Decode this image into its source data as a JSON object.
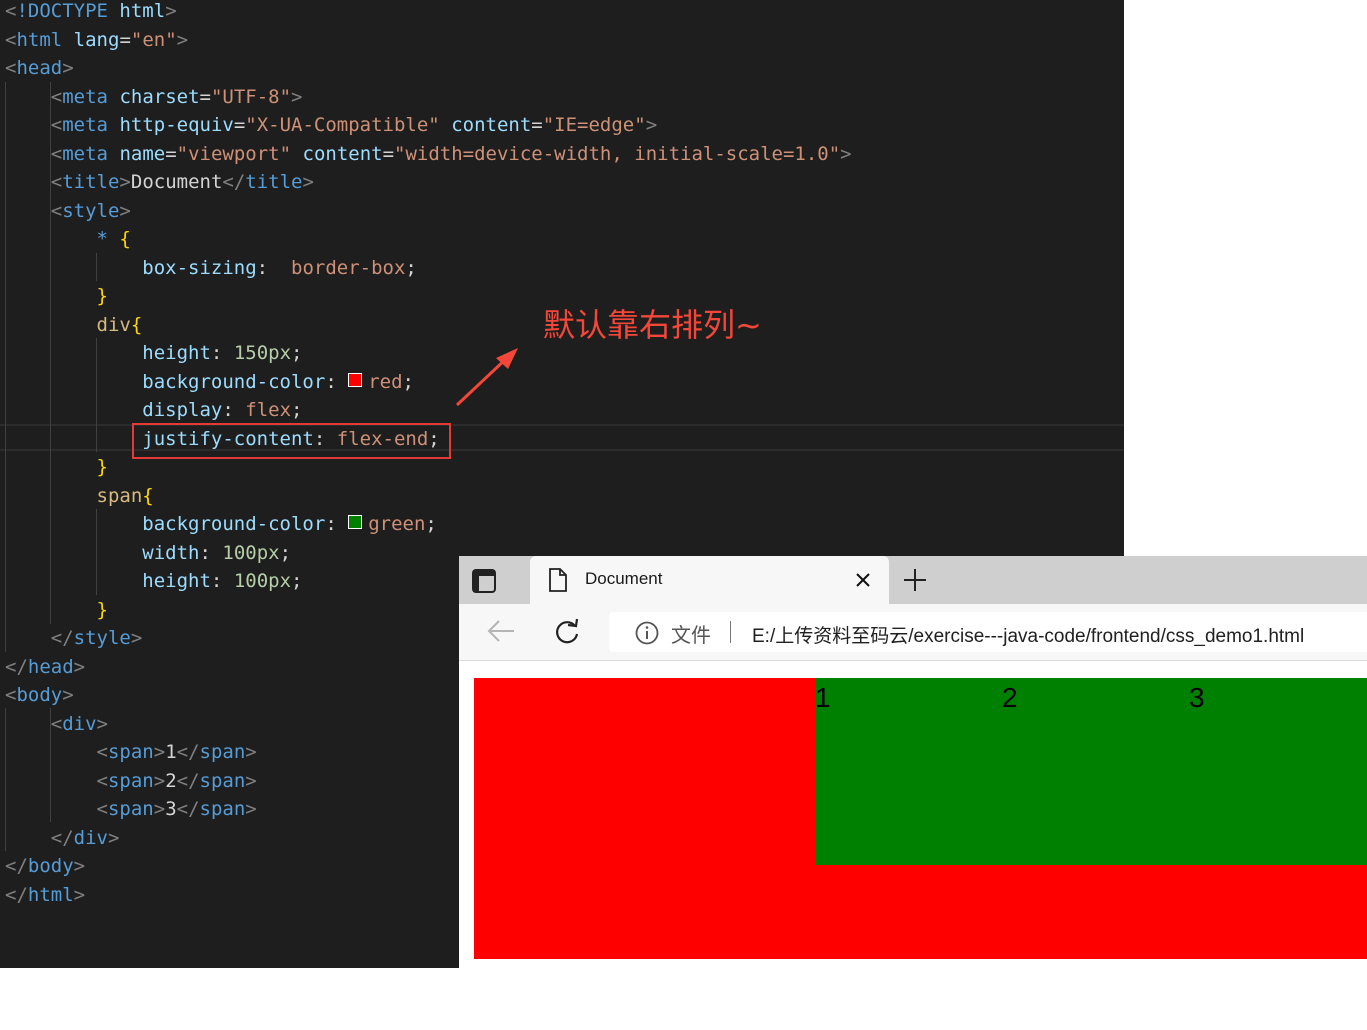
{
  "editor": {
    "lines": [
      [
        [
          "punc",
          "<"
        ],
        [
          "tag",
          "!DOCTYPE"
        ],
        [
          "text",
          " "
        ],
        [
          "attr",
          "html"
        ],
        [
          "punc",
          ">"
        ]
      ],
      [
        [
          "punc",
          "<"
        ],
        [
          "tag",
          "html"
        ],
        [
          "text",
          " "
        ],
        [
          "attr",
          "lang"
        ],
        [
          "text",
          "="
        ],
        [
          "str",
          "\"en\""
        ],
        [
          "punc",
          ">"
        ]
      ],
      [
        [
          "punc",
          "<"
        ],
        [
          "tag",
          "head"
        ],
        [
          "punc",
          ">"
        ]
      ],
      [
        [
          "text",
          "    "
        ],
        [
          "punc",
          "<"
        ],
        [
          "tag",
          "meta"
        ],
        [
          "text",
          " "
        ],
        [
          "attr",
          "charset"
        ],
        [
          "text",
          "="
        ],
        [
          "str",
          "\"UTF-8\""
        ],
        [
          "punc",
          ">"
        ]
      ],
      [
        [
          "text",
          "    "
        ],
        [
          "punc",
          "<"
        ],
        [
          "tag",
          "meta"
        ],
        [
          "text",
          " "
        ],
        [
          "attr",
          "http-equiv"
        ],
        [
          "text",
          "="
        ],
        [
          "str",
          "\"X-UA-Compatible\""
        ],
        [
          "text",
          " "
        ],
        [
          "attr",
          "content"
        ],
        [
          "text",
          "="
        ],
        [
          "str",
          "\"IE=edge\""
        ],
        [
          "punc",
          ">"
        ]
      ],
      [
        [
          "text",
          "    "
        ],
        [
          "punc",
          "<"
        ],
        [
          "tag",
          "meta"
        ],
        [
          "text",
          " "
        ],
        [
          "attr",
          "name"
        ],
        [
          "text",
          "="
        ],
        [
          "str",
          "\"viewport\""
        ],
        [
          "text",
          " "
        ],
        [
          "attr",
          "content"
        ],
        [
          "text",
          "="
        ],
        [
          "str",
          "\"width=device-width, initial-scale=1.0\""
        ],
        [
          "punc",
          ">"
        ]
      ],
      [
        [
          "text",
          "    "
        ],
        [
          "punc",
          "<"
        ],
        [
          "tag",
          "title"
        ],
        [
          "punc",
          ">"
        ],
        [
          "text",
          "Document"
        ],
        [
          "punc",
          "</"
        ],
        [
          "tag",
          "title"
        ],
        [
          "punc",
          ">"
        ]
      ],
      [
        [
          "text",
          "    "
        ],
        [
          "punc",
          "<"
        ],
        [
          "tag",
          "style"
        ],
        [
          "punc",
          ">"
        ]
      ],
      [
        [
          "text",
          "        "
        ],
        [
          "tag",
          "*"
        ],
        [
          "text",
          " "
        ],
        [
          "brace",
          "{"
        ]
      ],
      [
        [
          "text",
          "            "
        ],
        [
          "prop",
          "box-sizing"
        ],
        [
          "text",
          ":  "
        ],
        [
          "val",
          "border-box"
        ],
        [
          "text",
          ";"
        ]
      ],
      [
        [
          "text",
          "        "
        ],
        [
          "brace",
          "}"
        ]
      ],
      [
        [
          "text",
          "        "
        ],
        [
          "sel",
          "div"
        ],
        [
          "brace",
          "{"
        ]
      ],
      [
        [
          "text",
          "            "
        ],
        [
          "prop",
          "height"
        ],
        [
          "text",
          ": "
        ],
        [
          "num",
          "150px"
        ],
        [
          "text",
          ";"
        ]
      ],
      [
        [
          "text",
          "            "
        ],
        [
          "prop",
          "background-color"
        ],
        [
          "text",
          ": "
        ],
        [
          "swatch",
          "#ff0000"
        ],
        [
          "val",
          "red"
        ],
        [
          "text",
          ";"
        ]
      ],
      [
        [
          "text",
          "            "
        ],
        [
          "prop",
          "display"
        ],
        [
          "text",
          ": "
        ],
        [
          "val",
          "flex"
        ],
        [
          "text",
          ";"
        ]
      ],
      [
        [
          "text",
          "            "
        ],
        [
          "prop",
          "justify-content"
        ],
        [
          "text",
          ": "
        ],
        [
          "val",
          "flex-end"
        ],
        [
          "text",
          ";"
        ]
      ],
      [
        [
          "text",
          "        "
        ],
        [
          "brace",
          "}"
        ]
      ],
      [
        [
          "text",
          "        "
        ],
        [
          "sel",
          "span"
        ],
        [
          "brace",
          "{"
        ]
      ],
      [
        [
          "text",
          "            "
        ],
        [
          "prop",
          "background-color"
        ],
        [
          "text",
          ": "
        ],
        [
          "swatch",
          "#008000"
        ],
        [
          "val",
          "green"
        ],
        [
          "text",
          ";"
        ]
      ],
      [
        [
          "text",
          "            "
        ],
        [
          "prop",
          "width"
        ],
        [
          "text",
          ": "
        ],
        [
          "num",
          "100px"
        ],
        [
          "text",
          ";"
        ]
      ],
      [
        [
          "text",
          "            "
        ],
        [
          "prop",
          "height"
        ],
        [
          "text",
          ": "
        ],
        [
          "num",
          "100px"
        ],
        [
          "text",
          ";"
        ]
      ],
      [
        [
          "text",
          "        "
        ],
        [
          "brace",
          "}"
        ]
      ],
      [
        [
          "text",
          "    "
        ],
        [
          "punc",
          "</"
        ],
        [
          "tag",
          "style"
        ],
        [
          "punc",
          ">"
        ]
      ],
      [
        [
          "punc",
          "</"
        ],
        [
          "tag",
          "head"
        ],
        [
          "punc",
          ">"
        ]
      ],
      [
        [
          "punc",
          "<"
        ],
        [
          "tag",
          "body"
        ],
        [
          "punc",
          ">"
        ]
      ],
      [
        [
          "text",
          "    "
        ],
        [
          "punc",
          "<"
        ],
        [
          "tag",
          "div"
        ],
        [
          "punc",
          ">"
        ]
      ],
      [
        [
          "text",
          "        "
        ],
        [
          "punc",
          "<"
        ],
        [
          "tag",
          "span"
        ],
        [
          "punc",
          ">"
        ],
        [
          "text",
          "1"
        ],
        [
          "punc",
          "</"
        ],
        [
          "tag",
          "span"
        ],
        [
          "punc",
          ">"
        ]
      ],
      [
        [
          "text",
          "        "
        ],
        [
          "punc",
          "<"
        ],
        [
          "tag",
          "span"
        ],
        [
          "punc",
          ">"
        ],
        [
          "text",
          "2"
        ],
        [
          "punc",
          "</"
        ],
        [
          "tag",
          "span"
        ],
        [
          "punc",
          ">"
        ]
      ],
      [
        [
          "text",
          "        "
        ],
        [
          "punc",
          "<"
        ],
        [
          "tag",
          "span"
        ],
        [
          "punc",
          ">"
        ],
        [
          "text",
          "3"
        ],
        [
          "punc",
          "</"
        ],
        [
          "tag",
          "span"
        ],
        [
          "punc",
          ">"
        ]
      ],
      [
        [
          "text",
          "    "
        ],
        [
          "punc",
          "</"
        ],
        [
          "tag",
          "div"
        ],
        [
          "punc",
          ">"
        ]
      ],
      [
        [
          "punc",
          "</"
        ],
        [
          "tag",
          "body"
        ],
        [
          "punc",
          ">"
        ]
      ],
      [
        [
          "punc",
          "</"
        ],
        [
          "tag",
          "html"
        ],
        [
          "punc",
          ">"
        ]
      ]
    ]
  },
  "annotation": {
    "text": "默认靠右排列~",
    "color": "#f4473a"
  },
  "browser": {
    "tab_title": "Document",
    "close_glyph": "✕",
    "new_tab_glyph": "+",
    "address_label": "文件",
    "address_url": "E:/上传资料至码云/exercise---java-code/frontend/css_demo1.html",
    "icons": [
      "tab-actions-icon",
      "page-icon",
      "close-icon",
      "plus-icon",
      "back-arrow-icon",
      "reload-icon",
      "info-icon"
    ]
  },
  "demo": {
    "div_color": "#ff0000",
    "span_color": "#008000",
    "spans": [
      "1",
      "2",
      "3"
    ]
  }
}
